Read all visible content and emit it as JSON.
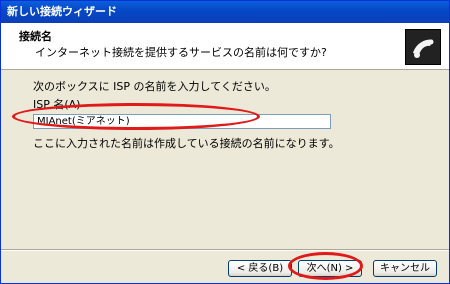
{
  "window": {
    "title": "新しい接続ウィザード"
  },
  "header": {
    "title": "接続名",
    "subtitle": "インターネット接続を提供するサービスの名前は何ですか?"
  },
  "body": {
    "instruction": "次のボックスに ISP の名前を入力してください。",
    "isp_label": "ISP 名(A)",
    "isp_value": "MIAnet(ミアネット)",
    "note": "ここに入力された名前は作成している接続の名前になります。"
  },
  "buttons": {
    "back": "< 戻る(B)",
    "next": "次へ(N) >",
    "cancel": "キャンセル"
  },
  "annotation": {
    "color": "#e01a1a"
  }
}
